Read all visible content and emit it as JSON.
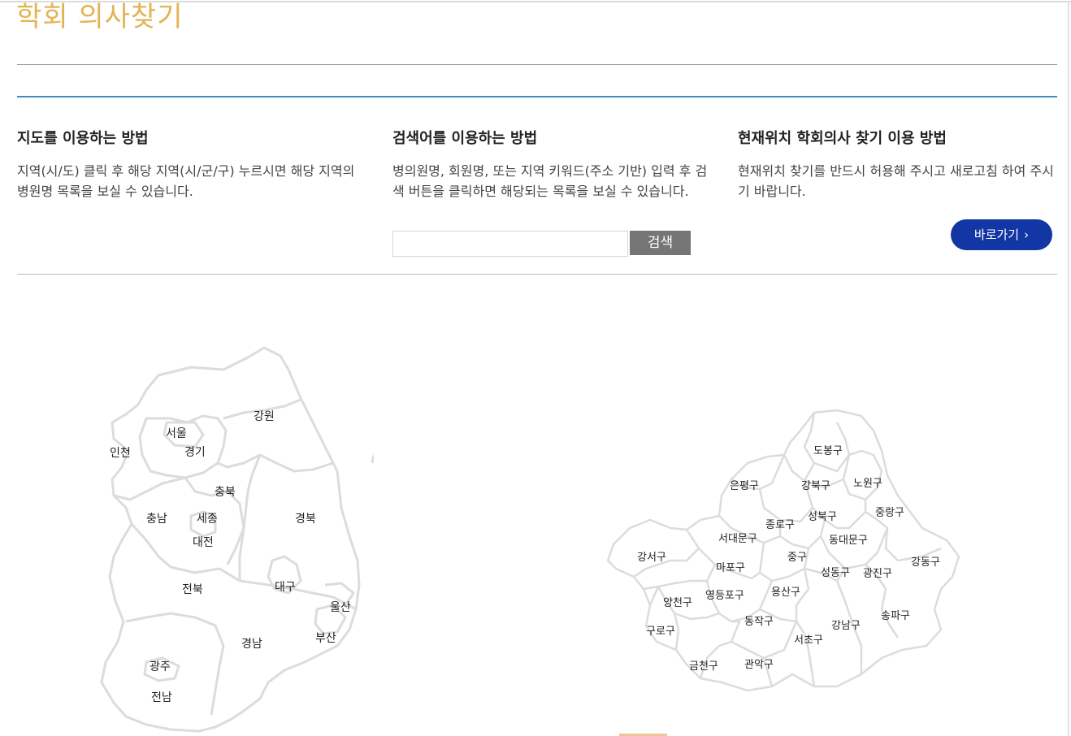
{
  "page": {
    "title": "학회 의사찾기"
  },
  "methods": [
    {
      "heading": "지도를 이용하는 방법",
      "desc": "지역(시/도) 클릭 후 해당 지역(시/군/구) 누르시면 해당 지역의 병원명 목록을 보실 수 있습니다."
    },
    {
      "heading": "검색어를 이용하는 방법",
      "desc": "병의원명, 회원명, 또는 지역 키워드(주소 기반) 입력 후 검색 버튼을 클릭하면 해당되는 목록을 보실 수 있습니다."
    },
    {
      "heading": "현재위치 학회의사 찾기 이용 방법",
      "desc": "현재위치 찾기를 반드시 허용해 주시고 새로고침 하여 주시기 바랍니다."
    }
  ],
  "search": {
    "placeholder": "",
    "value": "",
    "button_label": "검색"
  },
  "location": {
    "button_label": "바로가기",
    "icon": "chevron-right-icon"
  },
  "korea_map": {
    "regions": [
      "강원",
      "서울",
      "인천",
      "경기",
      "충북",
      "충남",
      "세종",
      "경북",
      "대전",
      "대구",
      "전북",
      "울산",
      "부산",
      "경남",
      "광주",
      "전남"
    ]
  },
  "seoul_map": {
    "districts": [
      "도봉구",
      "은평구",
      "강북구",
      "노원구",
      "종로구",
      "성북구",
      "중랑구",
      "서대문구",
      "동대문구",
      "강서구",
      "중구",
      "강동구",
      "마포구",
      "성동구",
      "광진구",
      "용산구",
      "양천구",
      "영등포구",
      "송파구",
      "동작구",
      "강남구",
      "구로구",
      "서초구",
      "금천구",
      "관악구"
    ]
  },
  "colors": {
    "title": "#e3b453",
    "accent_line": "#3f8ec1",
    "search_button": "#757575",
    "location_button": "#1236a3"
  }
}
